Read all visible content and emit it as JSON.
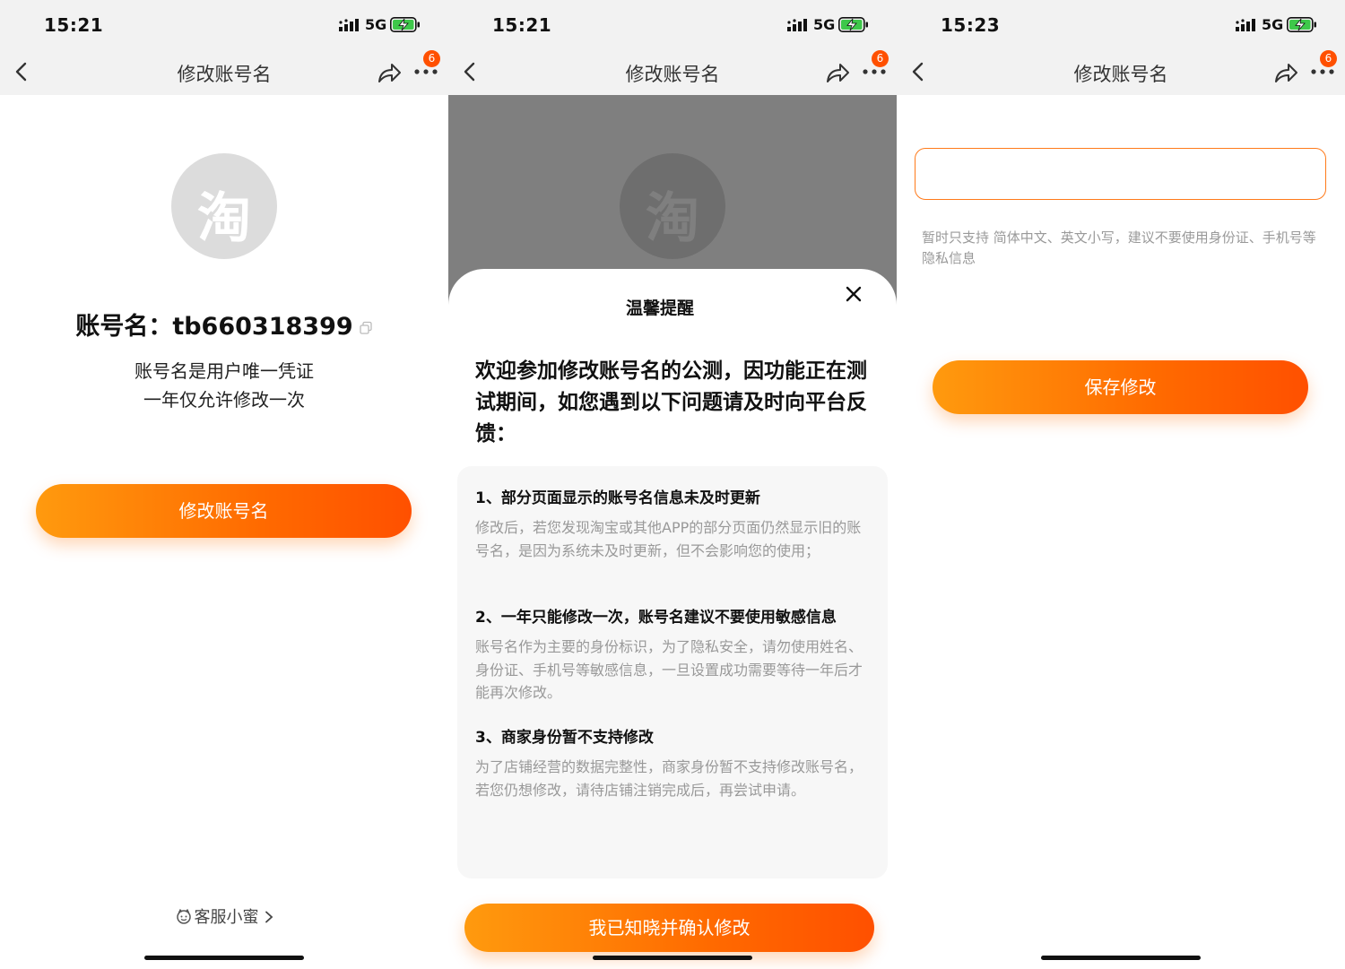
{
  "screens": [
    {
      "status": {
        "time": "15:21",
        "network": "5G"
      },
      "nav": {
        "title": "修改账号名",
        "badge": "6"
      },
      "account": {
        "label": "账号名：",
        "value": "tb660318399"
      },
      "logo_char": "淘",
      "desc_lines": [
        "账号名是用户唯一凭证",
        "一年仅允许修改一次"
      ],
      "button_label": "修改账号名",
      "service_label": "客服小蜜"
    },
    {
      "status": {
        "time": "15:21",
        "network": "5G"
      },
      "nav": {
        "title": "修改账号名",
        "badge": "6"
      },
      "logo_char": "淘",
      "sheet": {
        "title": "温馨提醒",
        "intro": "欢迎参加修改账号名的公测，因功能正在测试期间，如您遇到以下问题请及时向平台反馈：",
        "items": [
          {
            "heading": "1、部分页面显示的账号名信息未及时更新",
            "body": "修改后，若您发现淘宝或其他APP的部分页面仍然显示旧的账号名，是因为系统未及时更新，但不会影响您的使用；"
          },
          {
            "heading": "2、一年只能修改一次，账号名建议不要使用敏感信息",
            "body": "账号名作为主要的身份标识，为了隐私安全，请勿使用姓名、身份证、手机号等敏感信息，一旦设置成功需要等待一年后才能再次修改。"
          },
          {
            "heading": "3、商家身份暂不支持修改",
            "body": "为了店铺经营的数据完整性，商家身份暂不支持修改账号名，若您仍想修改，请待店铺注销完成后，再尝试申请。"
          }
        ],
        "confirm_label": "我已知晓并确认修改"
      }
    },
    {
      "status": {
        "time": "15:23",
        "network": "5G"
      },
      "nav": {
        "title": "修改账号名",
        "badge": "6"
      },
      "input_value": "",
      "hint": "暂时只支持 简体中文、英文小写，建议不要使用身份证、手机号等隐私信息",
      "save_label": "保存修改"
    }
  ],
  "colors": {
    "accent": "#ff5000",
    "accent_start": "#ff9a0e",
    "nav_bg": "#f2f2f2",
    "muted_text": "#999999"
  }
}
